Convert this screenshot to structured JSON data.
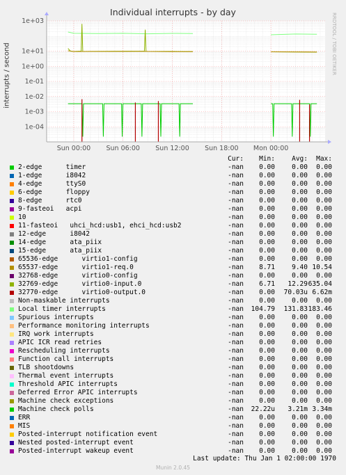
{
  "title": "Individual interrupts - by day",
  "side_text": "RRDTOOL / TOBI OETIKER",
  "ylabel": "interrupts / second",
  "legend_header": {
    "cur": "Cur:",
    "min": "Min:",
    "avg": "Avg:",
    "max": "Max:"
  },
  "legend": [
    {
      "name": "2-edge      timer",
      "color": "#00cc00",
      "cur": "-nan",
      "min": "0.00",
      "avg": "0.00",
      "max": "0.00"
    },
    {
      "name": "1-edge      i8042",
      "color": "#0066b3",
      "cur": "-nan",
      "min": "0.00",
      "avg": "0.00",
      "max": "0.00"
    },
    {
      "name": "4-edge      ttyS0",
      "color": "#ff8000",
      "cur": "-nan",
      "min": "0.00",
      "avg": "0.00",
      "max": "0.00"
    },
    {
      "name": "6-edge      floppy",
      "color": "#ffcc00",
      "cur": "-nan",
      "min": "0.00",
      "avg": "0.00",
      "max": "0.00"
    },
    {
      "name": "8-edge      rtc0",
      "color": "#330099",
      "cur": "-nan",
      "min": "0.00",
      "avg": "0.00",
      "max": "0.00"
    },
    {
      "name": "9-fasteoi   acpi",
      "color": "#990099",
      "cur": "-nan",
      "min": "0.00",
      "avg": "0.00",
      "max": "0.00"
    },
    {
      "name": "10",
      "color": "#ccff00",
      "cur": "-nan",
      "min": "0.00",
      "avg": "0.00",
      "max": "0.00"
    },
    {
      "name": "11-fasteoi   uhci_hcd:usb1, ehci_hcd:usb2",
      "color": "#ff0000",
      "cur": "-nan",
      "min": "0.00",
      "avg": "0.00",
      "max": "0.00"
    },
    {
      "name": "12-edge      i8042",
      "color": "#808080",
      "cur": "-nan",
      "min": "0.00",
      "avg": "0.00",
      "max": "0.00"
    },
    {
      "name": "14-edge      ata_piix",
      "color": "#008f00",
      "cur": "-nan",
      "min": "0.00",
      "avg": "0.00",
      "max": "0.00"
    },
    {
      "name": "15-edge      ata_piix",
      "color": "#00487d",
      "cur": "-nan",
      "min": "0.00",
      "avg": "0.00",
      "max": "0.00"
    },
    {
      "name": "65536-edge      virtio1-config",
      "color": "#b35a00",
      "cur": "-nan",
      "min": "0.00",
      "avg": "0.00",
      "max": "0.00"
    },
    {
      "name": "65537-edge      virtio1-req.0",
      "color": "#b38f00",
      "cur": "-nan",
      "min": "8.71",
      "avg": "9.40",
      "max": "10.54"
    },
    {
      "name": "32768-edge      virtio0-config",
      "color": "#6b006b",
      "cur": "-nan",
      "min": "0.00",
      "avg": "0.00",
      "max": "0.00"
    },
    {
      "name": "32769-edge      virtio0-input.0",
      "color": "#8fb300",
      "cur": "-nan",
      "min": "6.71",
      "avg": "12.29",
      "max": "635.04"
    },
    {
      "name": "32770-edge      virtio0-output.0",
      "color": "#b30000",
      "cur": "-nan",
      "min": "0.00",
      "avg": "70.03u",
      "max": "6.62m"
    },
    {
      "name": "Non-maskable interrupts",
      "color": "#bebebe",
      "cur": "-nan",
      "min": "0.00",
      "avg": "0.00",
      "max": "0.00"
    },
    {
      "name": "Local timer interrupts",
      "color": "#80ff80",
      "cur": "-nan",
      "min": "104.79",
      "avg": "131.83",
      "max": "183.46"
    },
    {
      "name": "Spurious interrupts",
      "color": "#80c9ff",
      "cur": "-nan",
      "min": "0.00",
      "avg": "0.00",
      "max": "0.00"
    },
    {
      "name": "Performance monitoring interrupts",
      "color": "#ffc080",
      "cur": "-nan",
      "min": "0.00",
      "avg": "0.00",
      "max": "0.00"
    },
    {
      "name": "IRQ work interrupts",
      "color": "#ffe680",
      "cur": "-nan",
      "min": "0.00",
      "avg": "0.00",
      "max": "0.00"
    },
    {
      "name": "APIC ICR read retries",
      "color": "#aa80ff",
      "cur": "-nan",
      "min": "0.00",
      "avg": "0.00",
      "max": "0.00"
    },
    {
      "name": "Rescheduling interrupts",
      "color": "#ee00cc",
      "cur": "-nan",
      "min": "0.00",
      "avg": "0.00",
      "max": "0.00"
    },
    {
      "name": "Function call interrupts",
      "color": "#ff8080",
      "cur": "-nan",
      "min": "0.00",
      "avg": "0.00",
      "max": "0.00"
    },
    {
      "name": "TLB shootdowns",
      "color": "#666600",
      "cur": "-nan",
      "min": "0.00",
      "avg": "0.00",
      "max": "0.00"
    },
    {
      "name": "Thermal event interrupts",
      "color": "#ffbfff",
      "cur": "-nan",
      "min": "0.00",
      "avg": "0.00",
      "max": "0.00"
    },
    {
      "name": "Threshold APIC interrupts",
      "color": "#00ffcc",
      "cur": "-nan",
      "min": "0.00",
      "avg": "0.00",
      "max": "0.00"
    },
    {
      "name": "Deferred Error APIC interrupts",
      "color": "#cc6699",
      "cur": "-nan",
      "min": "0.00",
      "avg": "0.00",
      "max": "0.00"
    },
    {
      "name": "Machine check exceptions",
      "color": "#999900",
      "cur": "-nan",
      "min": "0.00",
      "avg": "0.00",
      "max": "0.00"
    },
    {
      "name": "Machine check polls",
      "color": "#00cc00",
      "cur": "-nan",
      "min": "22.22u",
      "avg": "3.21m",
      "max": "3.34m"
    },
    {
      "name": "ERR",
      "color": "#0066b3",
      "cur": "-nan",
      "min": "0.00",
      "avg": "0.00",
      "max": "0.00"
    },
    {
      "name": "MIS",
      "color": "#ff8000",
      "cur": "-nan",
      "min": "0.00",
      "avg": "0.00",
      "max": "0.00"
    },
    {
      "name": "Posted-interrupt notification event",
      "color": "#ffcc00",
      "cur": "-nan",
      "min": "0.00",
      "avg": "0.00",
      "max": "0.00"
    },
    {
      "name": "Nested posted-interrupt event",
      "color": "#330099",
      "cur": "-nan",
      "min": "0.00",
      "avg": "0.00",
      "max": "0.00"
    },
    {
      "name": "Posted-interrupt wakeup event",
      "color": "#990099",
      "cur": "-nan",
      "min": "0.00",
      "avg": "0.00",
      "max": "0.00"
    }
  ],
  "footer": "Last update: Thu Jan  1 02:00:00 1970",
  "munin_version": "Munin 2.0.45",
  "chart_data": {
    "type": "line",
    "title": "Individual interrupts - by day",
    "ylabel": "interrupts / second",
    "yscale": "log",
    "ylim": [
      1e-05,
      1000
    ],
    "yticks": [
      {
        "v": 1000,
        "label": "1e+03"
      },
      {
        "v": 10,
        "label": "1e+01"
      },
      {
        "v": 1,
        "label": "1e+00"
      },
      {
        "v": 0.1,
        "label": "1e-01"
      },
      {
        "v": 0.01,
        "label": "1e-02"
      },
      {
        "v": 0.001,
        "label": "1e-03"
      },
      {
        "v": 0.0001,
        "label": "1e-04"
      }
    ],
    "xlim_hours": [
      -3.3,
      30.6
    ],
    "xticks": [
      {
        "h": 0,
        "label": "Sun 00:00"
      },
      {
        "h": 6,
        "label": "Sun 06:00"
      },
      {
        "h": 12,
        "label": "Sun 12:00"
      },
      {
        "h": 18,
        "label": "Sun 18:00"
      },
      {
        "h": 24,
        "label": "Mon 00:00"
      }
    ],
    "grid": true,
    "series": [
      {
        "name": "Local timer interrupts",
        "color": "#80ff80",
        "points": [
          [
            -0.7,
            183
          ],
          [
            0,
            150
          ],
          [
            3,
            145
          ],
          [
            6,
            150
          ],
          [
            9,
            140
          ],
          [
            12,
            148
          ],
          [
            14.5,
            145
          ],
          [
            24,
            120
          ],
          [
            27,
            135
          ],
          [
            29.6,
            130
          ]
        ],
        "gap_after_hour": 14.5
      },
      {
        "name": "32769-edge      virtio0-input.0",
        "color": "#8fb300",
        "points": [
          [
            -0.7,
            15
          ],
          [
            -0.4,
            10
          ],
          [
            0,
            9.5
          ],
          [
            0.9,
            10
          ],
          [
            1.0,
            635
          ],
          [
            1.1,
            9.5
          ],
          [
            4,
            9.8
          ],
          [
            8.6,
            10
          ],
          [
            8.7,
            260
          ],
          [
            8.8,
            9.5
          ],
          [
            12,
            9.6
          ],
          [
            14.5,
            9.4
          ],
          [
            24,
            9
          ],
          [
            27,
            8.8
          ],
          [
            29.6,
            8.5
          ]
        ],
        "gap_after_hour": 14.5
      },
      {
        "name": "65537-edge      virtio1-req.0",
        "color": "#b38f00",
        "points": [
          [
            -0.7,
            10.5
          ],
          [
            0,
            9.4
          ],
          [
            4,
            9.5
          ],
          [
            8,
            9.6
          ],
          [
            12,
            9.3
          ],
          [
            14.5,
            9.2
          ],
          [
            24,
            9.0
          ],
          [
            27,
            8.9
          ],
          [
            29.6,
            8.8
          ]
        ],
        "gap_after_hour": 14.5
      },
      {
        "name": "Machine check polls",
        "color": "#00cc00",
        "points": [
          [
            -0.7,
            0.00334
          ],
          [
            14.5,
            0.00334
          ],
          [
            24,
            0.00334
          ],
          [
            29.6,
            0.00334
          ]
        ],
        "dips_hours": [
          1.1,
          3.6,
          5.9,
          8.3,
          10.6,
          12.9,
          24.3,
          26.6,
          28.8
        ],
        "dip_value": 2.22e-05,
        "gap_after_hour": 14.5
      },
      {
        "name": "32770-edge      virtio0-output.0",
        "color": "#b30000",
        "points": [
          [
            1.0,
            0.00662
          ],
          [
            7.5,
            0.004
          ],
          [
            10.3,
            0.005
          ],
          [
            27.5,
            0.006
          ],
          [
            28.7,
            0.003
          ]
        ]
      }
    ]
  }
}
